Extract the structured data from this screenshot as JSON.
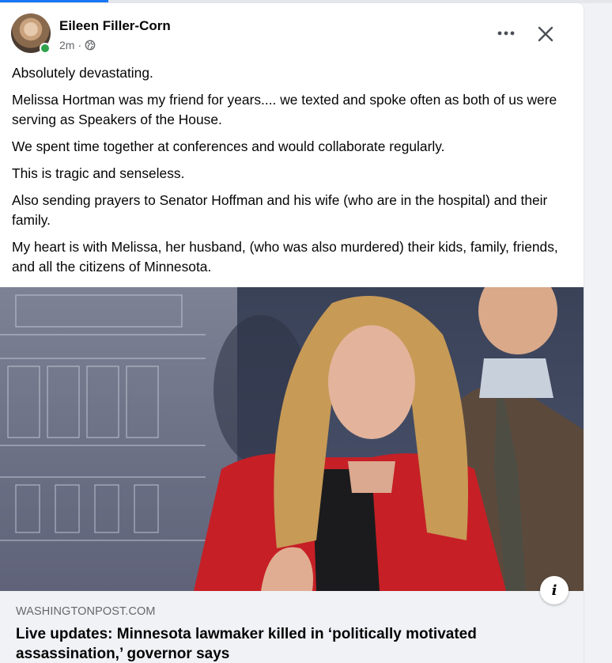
{
  "post": {
    "author": "Eileen Filler-Corn",
    "time": "2m",
    "separator": "·",
    "privacy_icon": "globe-icon",
    "paragraphs": [
      "Absolutely devastating.",
      "Melissa Hortman was my friend for years.... we texted and spoke often as both of us were serving as Speakers of the House.",
      "We spent time together at conferences and would collaborate regularly.",
      "This is tragic and senseless.",
      "Also sending prayers to Senator Hoffman and his wife (who are in the hospital) and their family.",
      "My heart is with Melissa, her husband, (who was also murdered) their kids,  family, friends, and all the citizens of Minnesota."
    ]
  },
  "link": {
    "domain": "WASHINGTONPOST.COM",
    "headline": "Live updates: Minnesota lawmaker killed in ‘politically motivated assassination,’ governor says",
    "info_label": "i"
  },
  "colors": {
    "accent": "#1877f2",
    "online": "#31a24c",
    "text": "#050505",
    "secondary": "#65676b"
  }
}
